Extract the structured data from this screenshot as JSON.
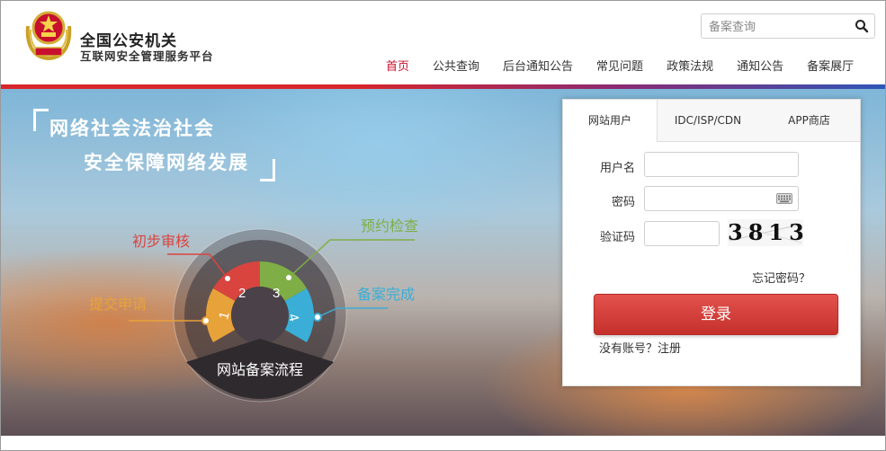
{
  "header": {
    "title": "全国公安机关",
    "subtitle": "互联网安全管理服务平台",
    "search_placeholder": "备案查询"
  },
  "nav": {
    "items": [
      "首页",
      "公共查询",
      "后台通知公告",
      "常见问题",
      "政策法规",
      "通知公告",
      "备案展厅"
    ],
    "active_index": 0
  },
  "banner": {
    "slogan_line1": "网络社会法治社会",
    "slogan_line2": "安全保障网络发展",
    "flow_title": "网站备案流程",
    "steps": [
      {
        "number": "1",
        "label": "提交申请",
        "color": "#e8a23a"
      },
      {
        "number": "2",
        "label": "初步审核",
        "color": "#d9443f"
      },
      {
        "number": "3",
        "label": "预约检查",
        "color": "#7fae47"
      },
      {
        "number": "4",
        "label": "备案完成",
        "color": "#3aaed6"
      }
    ]
  },
  "login": {
    "tabs": [
      "网站用户",
      "IDC/ISP/CDN",
      "APP商店"
    ],
    "active_tab": 0,
    "username_label": "用户名",
    "password_label": "密码",
    "captcha_label": "验证码",
    "captcha_code": "3813",
    "forgot_password": "忘记密码？",
    "login_button": "登录",
    "register_text": "没有账号？注册"
  },
  "colors": {
    "accent_red": "#c8102e",
    "login_button": "#d9403b"
  }
}
